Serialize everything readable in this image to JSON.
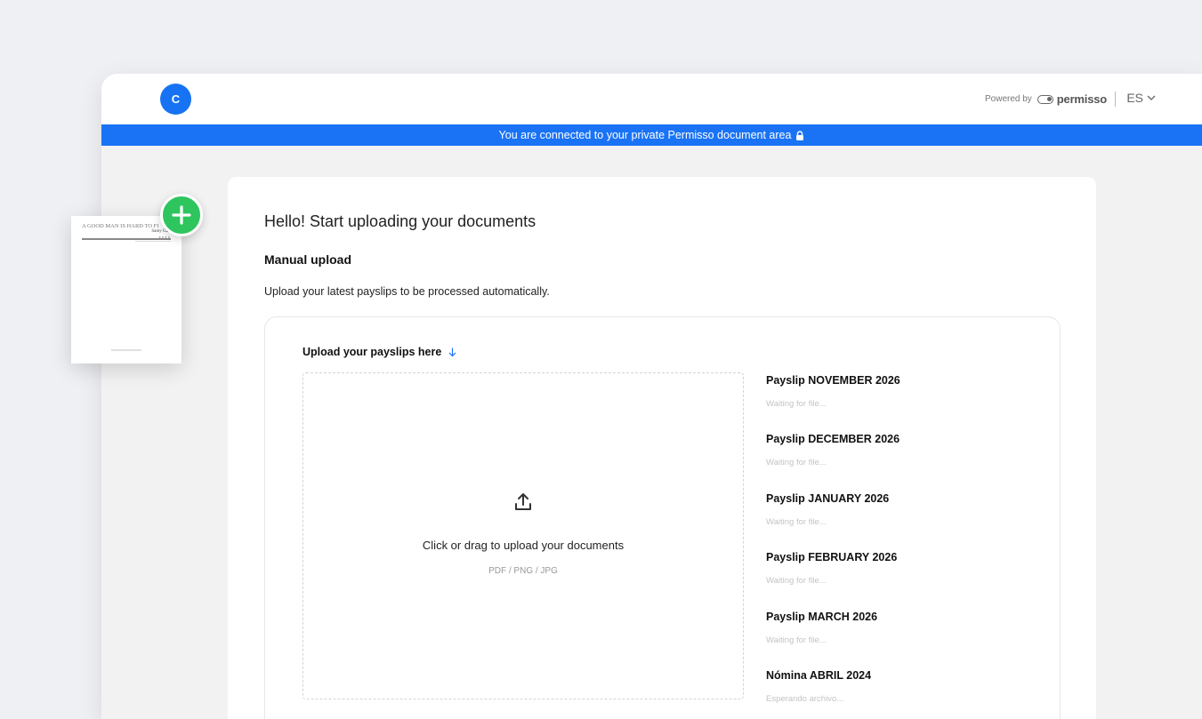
{
  "header": {
    "avatar_letter": "C",
    "powered_by": "Powered by",
    "brand": "permisso",
    "language": "ES"
  },
  "banner": {
    "text": "You are connected to your private Permisso document area"
  },
  "main": {
    "greeting": "Hello! Start uploading your documents",
    "section_title": "Manual upload",
    "description": "Upload your latest payslips to be processed automatically."
  },
  "upload": {
    "title": "Upload your payslips here",
    "dropzone_text": "Click or drag to upload your documents",
    "formats": "PDF / PNG / JPG"
  },
  "payslips": [
    {
      "title": "Payslip NOVEMBER 2026",
      "status": "Waiting for file..."
    },
    {
      "title": "Payslip DECEMBER 2026",
      "status": "Waiting for file..."
    },
    {
      "title": "Payslip JANUARY 2026",
      "status": "Waiting for file..."
    },
    {
      "title": "Payslip FEBRUARY 2026",
      "status": "Waiting for file..."
    },
    {
      "title": "Payslip MARCH 2026",
      "status": "Waiting for file..."
    },
    {
      "title": "Nómina ABRIL 2024",
      "status": "Esperando archivo..."
    }
  ],
  "floating_document": {
    "title": "A GOOD MAN IS HARD TO FI",
    "subtitle": "Samy Gaur"
  },
  "colors": {
    "accent": "#1a73f5",
    "add_button": "#2ec55e"
  },
  "icons": {
    "lock": "lock-icon",
    "upload": "upload-icon",
    "add": "plus-icon",
    "language": "chevron-down-icon"
  }
}
